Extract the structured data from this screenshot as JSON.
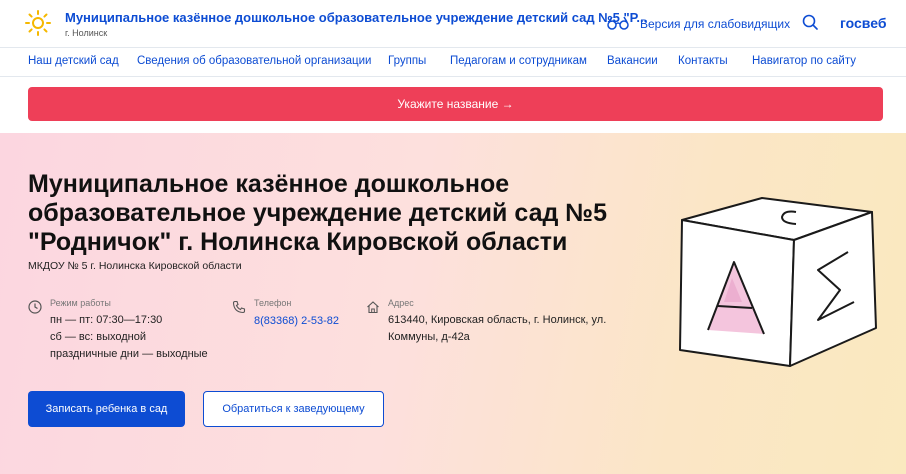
{
  "header": {
    "site_title": "Муниципальное казённое дошкольное образовательное учреждение детский сад №5 \"Р...",
    "city": "г. Нолинск",
    "accessibility_label": "Версия для слабовидящих",
    "brand": "госвеб"
  },
  "nav": {
    "items": [
      {
        "label": "Наш детский сад"
      },
      {
        "label": "Сведения об образовательной организации"
      },
      {
        "label": "Группы"
      },
      {
        "label": "Педагогам и сотрудникам"
      },
      {
        "label": "Вакансии"
      },
      {
        "label": "Контакты"
      },
      {
        "label": "Навигатор по сайту"
      }
    ]
  },
  "banner": {
    "label": "Укажите название  →"
  },
  "hero": {
    "title": "Муниципальное казённое дошкольное образовательное учреждение детский сад №5 \"Родничок\" г. Нолинска Кировской области",
    "subtitle": "МКДОУ № 5 г. Нолинска Кировской области",
    "hours": {
      "label": "Режим работы",
      "lines": [
        "пн — пт: 07:30—17:30",
        "сб — вс: выходной",
        "праздничные дни — выходные"
      ]
    },
    "phone": {
      "label": "Телефон",
      "value": "8(83368) 2-53-82"
    },
    "address": {
      "label": "Адрес",
      "lines": [
        "613440, Кировская область, г. Нолинск, ул.",
        "Коммуны, д-42а"
      ]
    },
    "primary_button": "Записать ребенка в сад",
    "secondary_button": "Обратиться к заведующему"
  },
  "colors": {
    "accent": "#0d4cd3",
    "banner": "#ee3f58",
    "logo": "#f5b800"
  }
}
